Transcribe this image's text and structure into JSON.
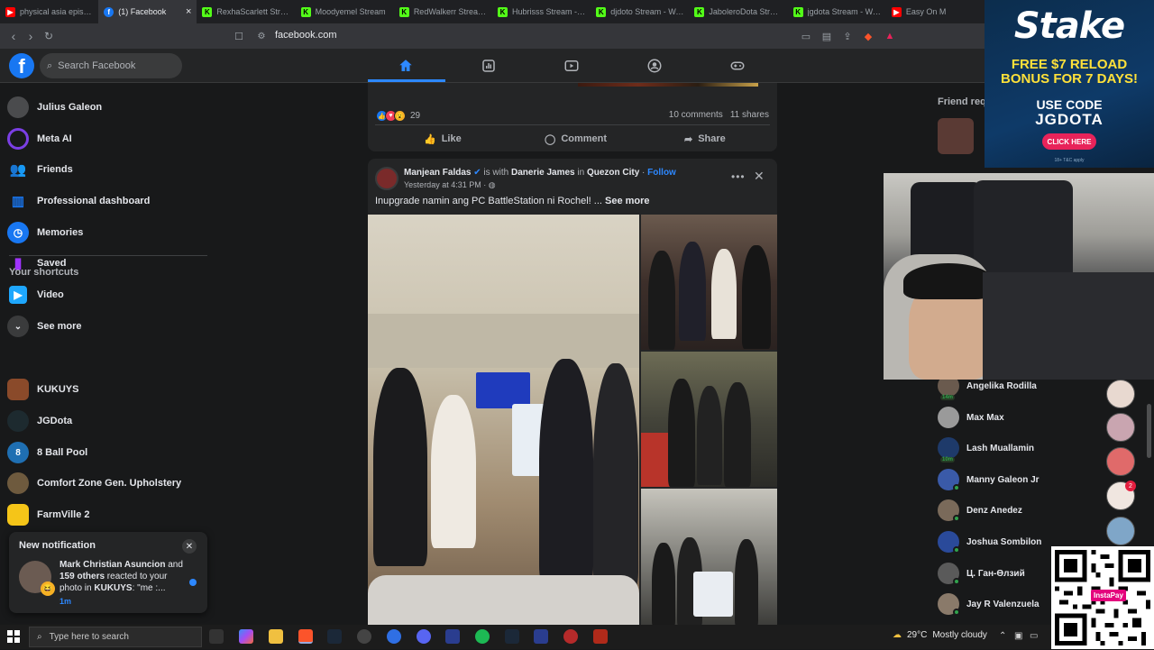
{
  "browser": {
    "tabs": [
      {
        "label": "physical asia episode",
        "favicon": "youtube-icon",
        "active": false
      },
      {
        "label": "(1) Facebook",
        "favicon": "facebook-icon",
        "active": true
      },
      {
        "label": "RexhaScarlett Stream",
        "favicon": "kick-icon",
        "active": false
      },
      {
        "label": "Moodyemel Stream",
        "favicon": "kick-icon",
        "active": false
      },
      {
        "label": "RedWalkerr Stream - W",
        "favicon": "kick-icon",
        "active": false
      },
      {
        "label": "Hubrisss Stream - Wate",
        "favicon": "kick-icon",
        "active": false
      },
      {
        "label": "djdoto Stream - Watch",
        "favicon": "kick-icon",
        "active": false
      },
      {
        "label": "JaboleroDota Stream",
        "favicon": "kick-icon",
        "active": false
      },
      {
        "label": "jgdota Stream - Watch",
        "favicon": "kick-icon",
        "active": false
      },
      {
        "label": "Easy On M",
        "favicon": "youtube-icon",
        "active": false
      }
    ],
    "url": "facebook.com"
  },
  "header": {
    "logo": "f",
    "search_placeholder": "Search Facebook"
  },
  "sidebar": {
    "items": [
      {
        "label": "Julius Galeon",
        "icon": "avatar",
        "color": "#4a4b4d"
      },
      {
        "label": "Meta AI",
        "icon": "meta-ai-icon",
        "color": "#7b3fe4"
      },
      {
        "label": "Friends",
        "icon": "friends-icon",
        "color": "#1877f2"
      },
      {
        "label": "Professional dashboard",
        "icon": "dashboard-icon",
        "color": "#1877f2"
      },
      {
        "label": "Memories",
        "icon": "memories-icon",
        "color": "#1877f2"
      },
      {
        "label": "Saved",
        "icon": "saved-icon",
        "color": "#a033ff"
      },
      {
        "label": "Video",
        "icon": "video-icon",
        "color": "#1ea7fd"
      },
      {
        "label": "See more",
        "icon": "chevron-down-icon",
        "color": "#3a3b3c"
      }
    ],
    "shortcuts_title": "Your shortcuts",
    "shortcuts": [
      {
        "label": "KUKUYS",
        "color": "#8a4a2a"
      },
      {
        "label": "JGDota",
        "color": "#1d2a2f"
      },
      {
        "label": "8 Ball Pool",
        "color": "#1f6fb2"
      },
      {
        "label": "Comfort Zone Gen. Upholstery",
        "color": "#6e5a3e"
      },
      {
        "label": "FarmVille 2",
        "color": "#f5c518"
      }
    ]
  },
  "notification": {
    "title": "New notification",
    "actor": "Mark Christian Asuncion",
    "text_and": " and ",
    "others": "159 others",
    "text_reacted": " reacted to your photo in ",
    "group": "KUKUYS",
    "quote": ": \"me :...",
    "time": "1m"
  },
  "previous_post": {
    "reaction_count": "29",
    "comments": "10 comments",
    "shares": "11 shares",
    "like_label": "Like",
    "comment_label": "Comment",
    "share_label": "Share"
  },
  "post": {
    "author": "Manjean Faldas",
    "is_with": " is with ",
    "tagged": "Danerie James",
    "in_word": " in ",
    "location": "Quezon City",
    "follow": "Follow",
    "time": "Yesterday at 4:31 PM",
    "text": "Inupgrade namin ang PC BattleStation ni Rochel! ...",
    "see_more": "See more"
  },
  "right": {
    "friend_requests_title": "Friend req",
    "contacts": [
      {
        "name": "Angelika Rodilla",
        "color": "#6a5a4e",
        "online": false,
        "time": "14m"
      },
      {
        "name": "Max Max",
        "color": "#9a9a9a",
        "online": false,
        "time": ""
      },
      {
        "name": "Lash Muallamin",
        "color": "#1e3a6a",
        "online": false,
        "time": "10m"
      },
      {
        "name": "Manny Galeon Jr",
        "color": "#3a5aa8",
        "online": true,
        "time": ""
      },
      {
        "name": "Denz Anedez",
        "color": "#7a6a5a",
        "online": true,
        "time": ""
      },
      {
        "name": "Joshua Sombilon",
        "color": "#2a4a9a",
        "online": true,
        "time": ""
      },
      {
        "name": "Ц. Ган-Өлзий",
        "color": "#5a5a5a",
        "online": true,
        "time": ""
      },
      {
        "name": "Jay R Valenzuela",
        "color": "#8a7a6a",
        "online": true,
        "time": ""
      }
    ],
    "bubble_badge": "2"
  },
  "ad": {
    "brand": "Stake",
    "headline": "FREE $7 RELOAD BONUS FOR 7 DAYS!",
    "use_code": "USE CODE",
    "code": "JGDOTA",
    "cta": "CLICK HERE",
    "fine_print": "18+ T&C apply"
  },
  "qr_label": "InstaPay",
  "taskbar": {
    "search_placeholder": "Type here to search",
    "weather_temp": "29°C",
    "weather_desc": "Mostly cloudy"
  }
}
